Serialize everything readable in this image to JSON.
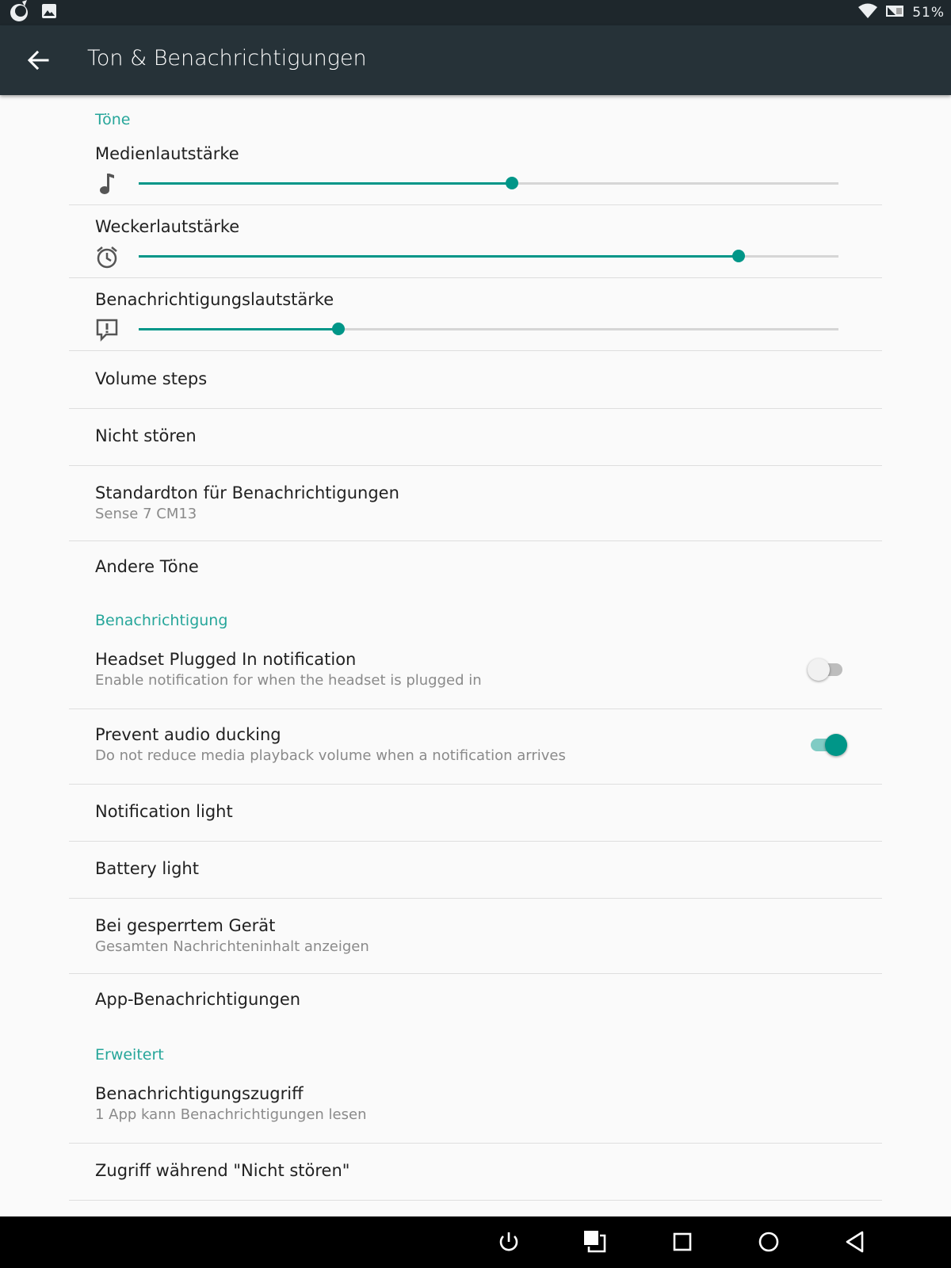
{
  "status_bar": {
    "icons_left": [
      "unicorn-icon",
      "image-icon"
    ],
    "icons_right": [
      "wifi-icon",
      "sim-icon"
    ],
    "battery_text": "51%"
  },
  "app_bar": {
    "title": "Ton & Benachrichtigungen",
    "back_icon": "arrow-back-icon"
  },
  "sections": {
    "tones": {
      "header": "Töne",
      "sliders": [
        {
          "label": "Medienlautstärke",
          "icon": "music-note-icon",
          "level": 0.533
        },
        {
          "label": "Weckerlautstärke",
          "icon": "alarm-clock-icon",
          "level": 0.857
        },
        {
          "label": "Benachrichtigungslautstärke",
          "icon": "notification-alert-icon",
          "level": 0.285
        }
      ],
      "items": [
        {
          "title": "Volume steps"
        },
        {
          "title": "Nicht stören"
        },
        {
          "title": "Standardton für Benachrichtigungen",
          "summary": "Sense 7 CM13"
        },
        {
          "title": "Andere Töne"
        }
      ]
    },
    "notification": {
      "header": "Benachrichtigung",
      "toggles": [
        {
          "title": "Headset Plugged In notification",
          "summary": "Enable notification for when the headset is plugged in",
          "checked": false
        },
        {
          "title": "Prevent audio ducking",
          "summary": "Do not reduce media playback volume when a notification arrives",
          "checked": true
        }
      ],
      "items": [
        {
          "title": "Notification light"
        },
        {
          "title": "Battery light"
        },
        {
          "title": "Bei gesperrtem Gerät",
          "summary": "Gesamten Nachrichteninhalt anzeigen"
        },
        {
          "title": "App-Benachrichtigungen"
        }
      ]
    },
    "advanced": {
      "header": "Erweitert",
      "items": [
        {
          "title": "Benachrichtigungszugriff",
          "summary": "1 App kann Benachrichtigungen lesen"
        },
        {
          "title": "Zugriff während \"Nicht stören\""
        }
      ]
    }
  },
  "nav_bar": {
    "buttons": [
      "power-icon",
      "screenshot-icon",
      "recents-icon",
      "home-icon",
      "back-triangle-icon"
    ]
  },
  "colors": {
    "accent": "#009688",
    "section_header": "#26a69a",
    "app_bar": "#263238",
    "status_bar": "#1e272c",
    "background": "#fafafa",
    "divider": "#dedede",
    "nav_bar": "#000000"
  }
}
